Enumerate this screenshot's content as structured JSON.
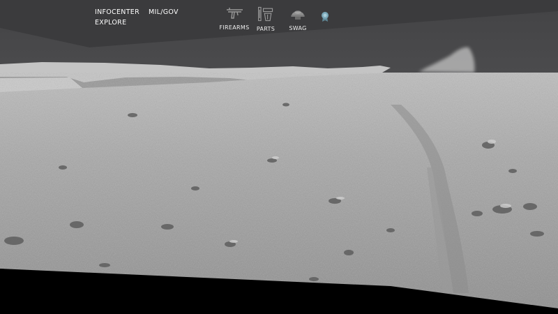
{
  "nav": {
    "infocenter": "INFOCENTER",
    "milgov": "MIL/GOV",
    "explore": "EXPLORE"
  },
  "categories": [
    {
      "label": "FIREARMS",
      "icon": "rifle-icon"
    },
    {
      "label": "PARTS",
      "icon": "parts-icon"
    },
    {
      "label": "SWAG",
      "icon": "helmet-icon"
    }
  ],
  "badge": {
    "icon": "ribbon-badge-icon",
    "color": "#7aa7b8"
  },
  "colors": {
    "header": "#3a3a3c",
    "sky": "#4a4a4c",
    "ground": "#9b9b9b",
    "ground_light": "#b9b9b9",
    "text": "#ffffff"
  }
}
